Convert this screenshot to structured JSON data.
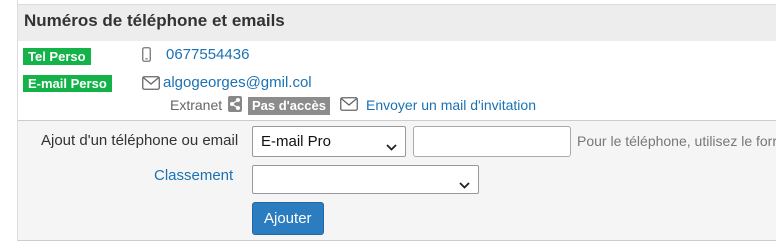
{
  "section": {
    "title": "Numéros de téléphone et emails"
  },
  "phone": {
    "badge": "Tel Perso",
    "icon": "mobile-phone-icon",
    "value": "0677554436"
  },
  "email": {
    "badge": "E-mail Perso",
    "icon": "envelope-icon",
    "value": "algogeorges@gmil.col"
  },
  "extranet": {
    "label": "Extranet",
    "share_icon": "share-icon",
    "status": "Pas d'accès",
    "invite_icon": "envelope-icon",
    "invite_link": "Envoyer un mail d'invitation"
  },
  "form": {
    "add_label": "Ajout d'un téléphone ou email",
    "type_select_value": "E-mail Pro",
    "value_input": "",
    "hint": "Pour le téléphone, utilisez le forr",
    "ranking_label": "Classement",
    "ranking_select_value": "",
    "submit_label": "Ajouter"
  },
  "colors": {
    "badge_green": "#14b34a",
    "link_blue": "#1a72b4",
    "button_blue": "#2b7dbf",
    "status_grey": "#8c8c8c"
  }
}
